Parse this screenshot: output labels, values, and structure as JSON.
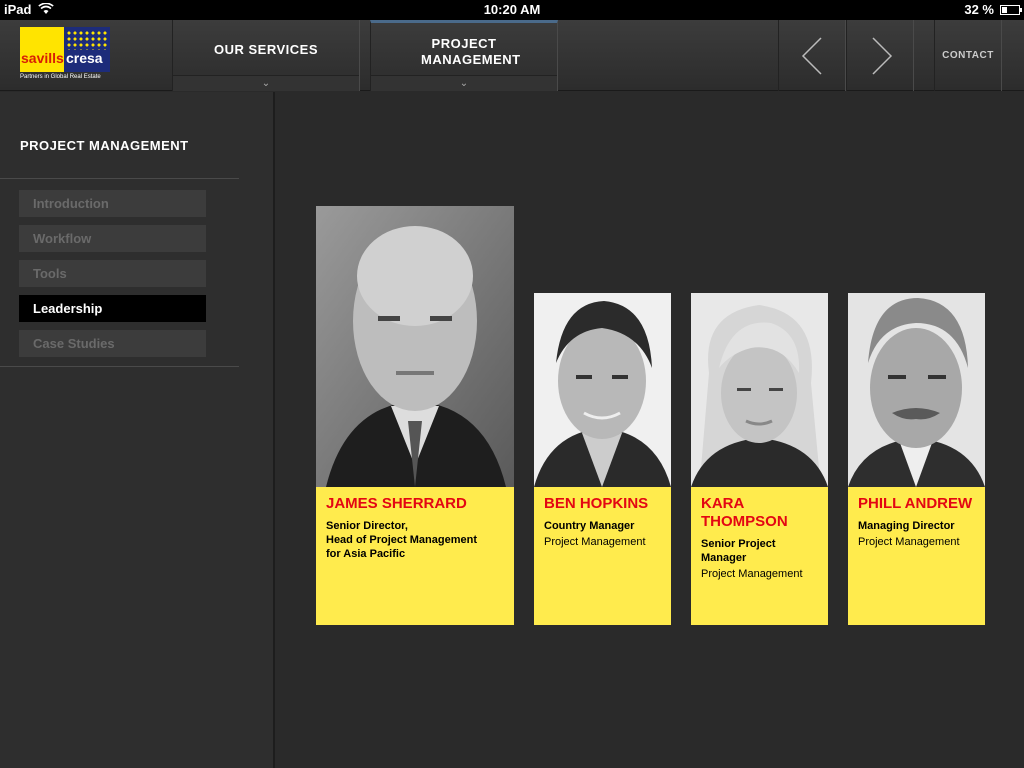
{
  "status": {
    "device": "iPad",
    "time": "10:20 AM",
    "battery": "32 %",
    "battery_level": 0.32
  },
  "logo": {
    "word1": "savills",
    "word2": "cresa",
    "tagline": "Partners in Global Real Estate"
  },
  "nav": {
    "services": "OUR SERVICES",
    "project": "PROJECT MANAGEMENT",
    "contact": "CONTACT"
  },
  "sidebar": {
    "heading": "PROJECT MANAGEMENT",
    "items": [
      {
        "label": "Introduction"
      },
      {
        "label": "Workflow"
      },
      {
        "label": "Tools"
      },
      {
        "label": "Leadership"
      },
      {
        "label": "Case Studies"
      }
    ],
    "active_index": 3
  },
  "people": [
    {
      "name": "JAMES SHERRARD",
      "role": "Senior Director,\nHead of Project Management\nfor Asia Pacific",
      "dept": ""
    },
    {
      "name": "BEN HOPKINS",
      "role": "Country Manager",
      "dept": "Project Management"
    },
    {
      "name": "KARA THOMPSON",
      "role": "Senior Project Manager",
      "dept": "Project Management"
    },
    {
      "name": "PHILL ANDREW",
      "role": "Managing Director",
      "dept": "Project Management"
    }
  ],
  "colors": {
    "accent_yellow": "#ffeb4d",
    "name_red": "#e30613",
    "bg": "#2a2a2a"
  }
}
